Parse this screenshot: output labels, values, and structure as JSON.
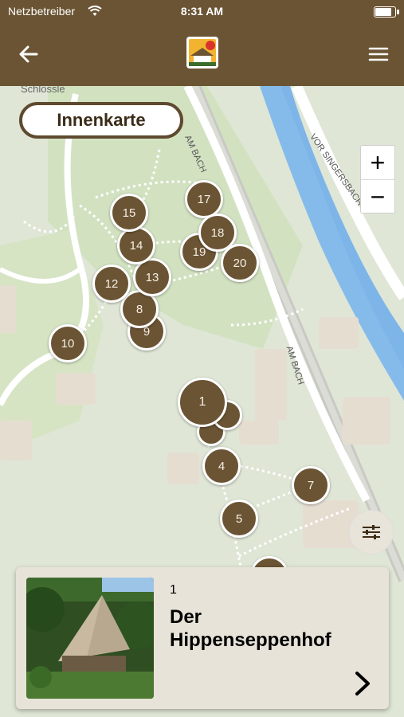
{
  "status": {
    "carrier": "Netzbetreiber",
    "time": "8:31 AM",
    "battery_level": 0.9
  },
  "navbar": {
    "back_icon": "back-arrow-icon",
    "logo_icon": "farmhouse-logo-icon",
    "menu_icon": "hamburger-menu-icon"
  },
  "map": {
    "innenkarte_label": "Innenkarte",
    "zoom_in_label": "+",
    "zoom_out_label": "−",
    "labels": {
      "schlossle": "Schlössle",
      "am_bach_top": "AM BACH",
      "am_bach_mid": "AM BACH",
      "vor_singersbach": "VOR SINGERSBACH"
    },
    "markers": [
      "1",
      "4",
      "5",
      "7",
      "8",
      "9",
      "10",
      "12",
      "13",
      "14",
      "15",
      "17",
      "18",
      "19",
      "20"
    ]
  },
  "filter_icon": "sliders-icon",
  "card": {
    "number": "1",
    "title": "Der Hippenseppenhof",
    "image": "hippenseppenhof-photo",
    "chevron_icon": "chevron-right-icon"
  }
}
